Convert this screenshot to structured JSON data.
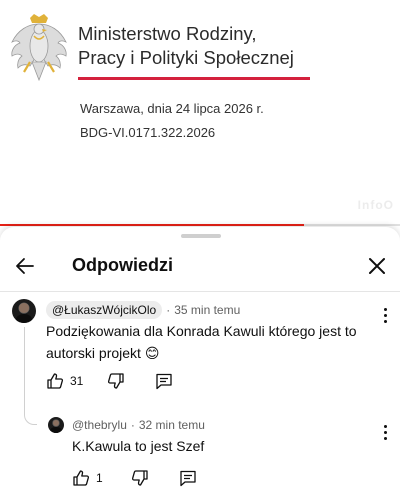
{
  "video": {
    "ministry_line1": "Ministerstwo Rodziny,",
    "ministry_line2": "Pracy i Polityki Społecznej",
    "place_date": "Warszawa, dnia 24 lipca 2026 r.",
    "reference": "BDG-VI.0171.322.2026",
    "watermark": "InfoO",
    "progress_fraction": 0.76,
    "accent_color": "#d4213d"
  },
  "panel": {
    "title": "Odpowiedzi",
    "back_icon": "arrow-left-icon",
    "close_icon": "close-icon"
  },
  "comment": {
    "author": "@ŁukaszWójcikOlo",
    "separator": "·",
    "time": "35 min temu",
    "text": "Podziękowania dla Konrada Kawuli którego jest to autorski projekt 😊",
    "likes": "31"
  },
  "reply": {
    "author": "@thebrylu",
    "separator": "·",
    "time": "32 min temu",
    "text": "K.Kawula to jest Szef",
    "likes": "1"
  }
}
